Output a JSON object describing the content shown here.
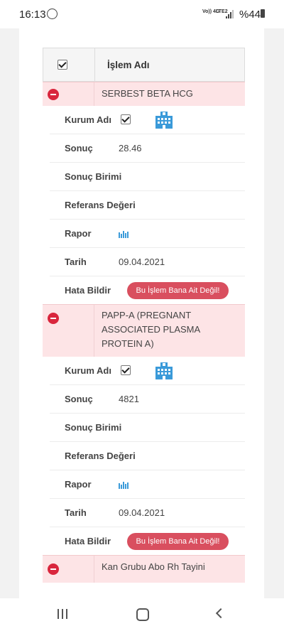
{
  "status": {
    "time": "16:13",
    "network": "Vo)) 4G",
    "lte": "LTE2",
    "battery": "%44"
  },
  "table": {
    "header_title": "İşlem Adı"
  },
  "labels": {
    "kurum": "Kurum Adı",
    "sonuc": "Sonuç",
    "birim": "Sonuç Birimi",
    "referans": "Referans Değeri",
    "rapor": "Rapor",
    "tarih": "Tarih",
    "hata": "Hata Bildir",
    "error_button": "Bu İşlem Bana Ait Değil!"
  },
  "records": [
    {
      "name": "SERBEST BETA HCG",
      "sonuc": "28.46",
      "birim": "",
      "referans": "",
      "tarih": "09.04.2021"
    },
    {
      "name_lines": [
        "PAPP-A (PREGNANT",
        "ASSOCIATED PLASMA",
        "PROTEIN A)"
      ],
      "sonuc": "4821",
      "birim": "",
      "referans": "",
      "tarih": "09.04.2021"
    },
    {
      "name": "Kan Grubu Abo Rh Tayini"
    }
  ],
  "icons": {
    "accent": "#3a9ad9",
    "minus_color": "#d9263d",
    "error_button_color": "#d94f5f",
    "row_highlight": "#fde4e6"
  }
}
